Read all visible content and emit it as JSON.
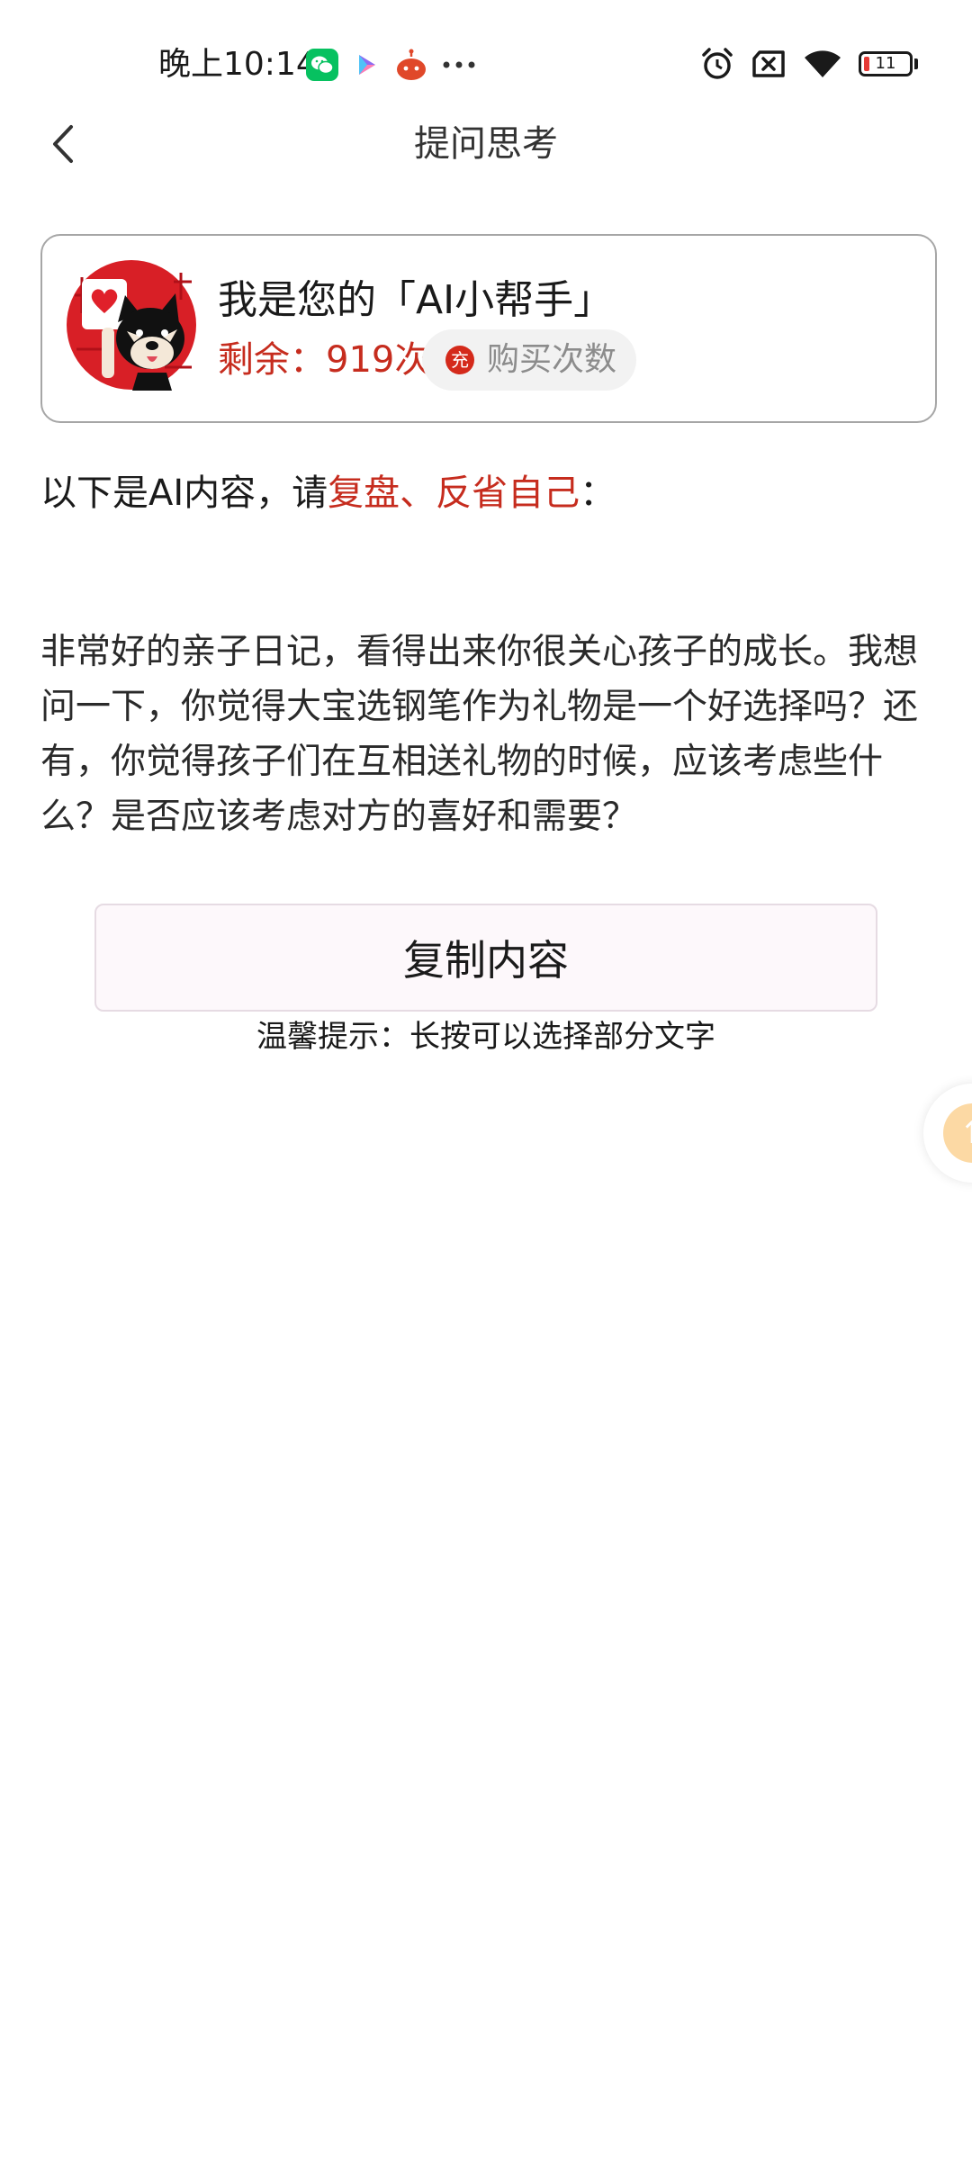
{
  "status_bar": {
    "time": "晚上10:14",
    "battery_level": "11",
    "battery_fill_fraction": 0.11,
    "left_icons": [
      "wechat-icon",
      "video-app-icon",
      "robot-app-icon",
      "more-dots-icon"
    ],
    "right_icons": [
      "alarm-icon",
      "no-sim-icon",
      "wifi-icon",
      "battery-icon"
    ]
  },
  "nav": {
    "title": "提问思考"
  },
  "assistant": {
    "name": "我是您的「AI小帮手」",
    "remaining": "剩余：919次",
    "buy_icon_char": "充",
    "buy_label": "购买次数"
  },
  "intro": {
    "prefix": "以下是AI内容，请",
    "highlight": "复盘、反省自己",
    "suffix": "："
  },
  "content": {
    "text": "非常好的亲子日记，看得出来你很关心孩子的成长。我想问一下，你觉得大宝选钢笔作为礼物是一个好选择吗？还有，你觉得孩子们在互相送礼物的时候，应该考虑些什么？是否应该考虑对方的喜好和需要？"
  },
  "actions": {
    "copy_label": "复制内容",
    "tip": "温馨提示：长按可以选择部分文字"
  },
  "colors": {
    "accent_red": "#c62c1e",
    "card_border": "#a6a6a6",
    "buy_pill_bg": "#f2f2f2",
    "copy_bg": "#fdf8fb",
    "float_orange": "#fcd9a4"
  }
}
